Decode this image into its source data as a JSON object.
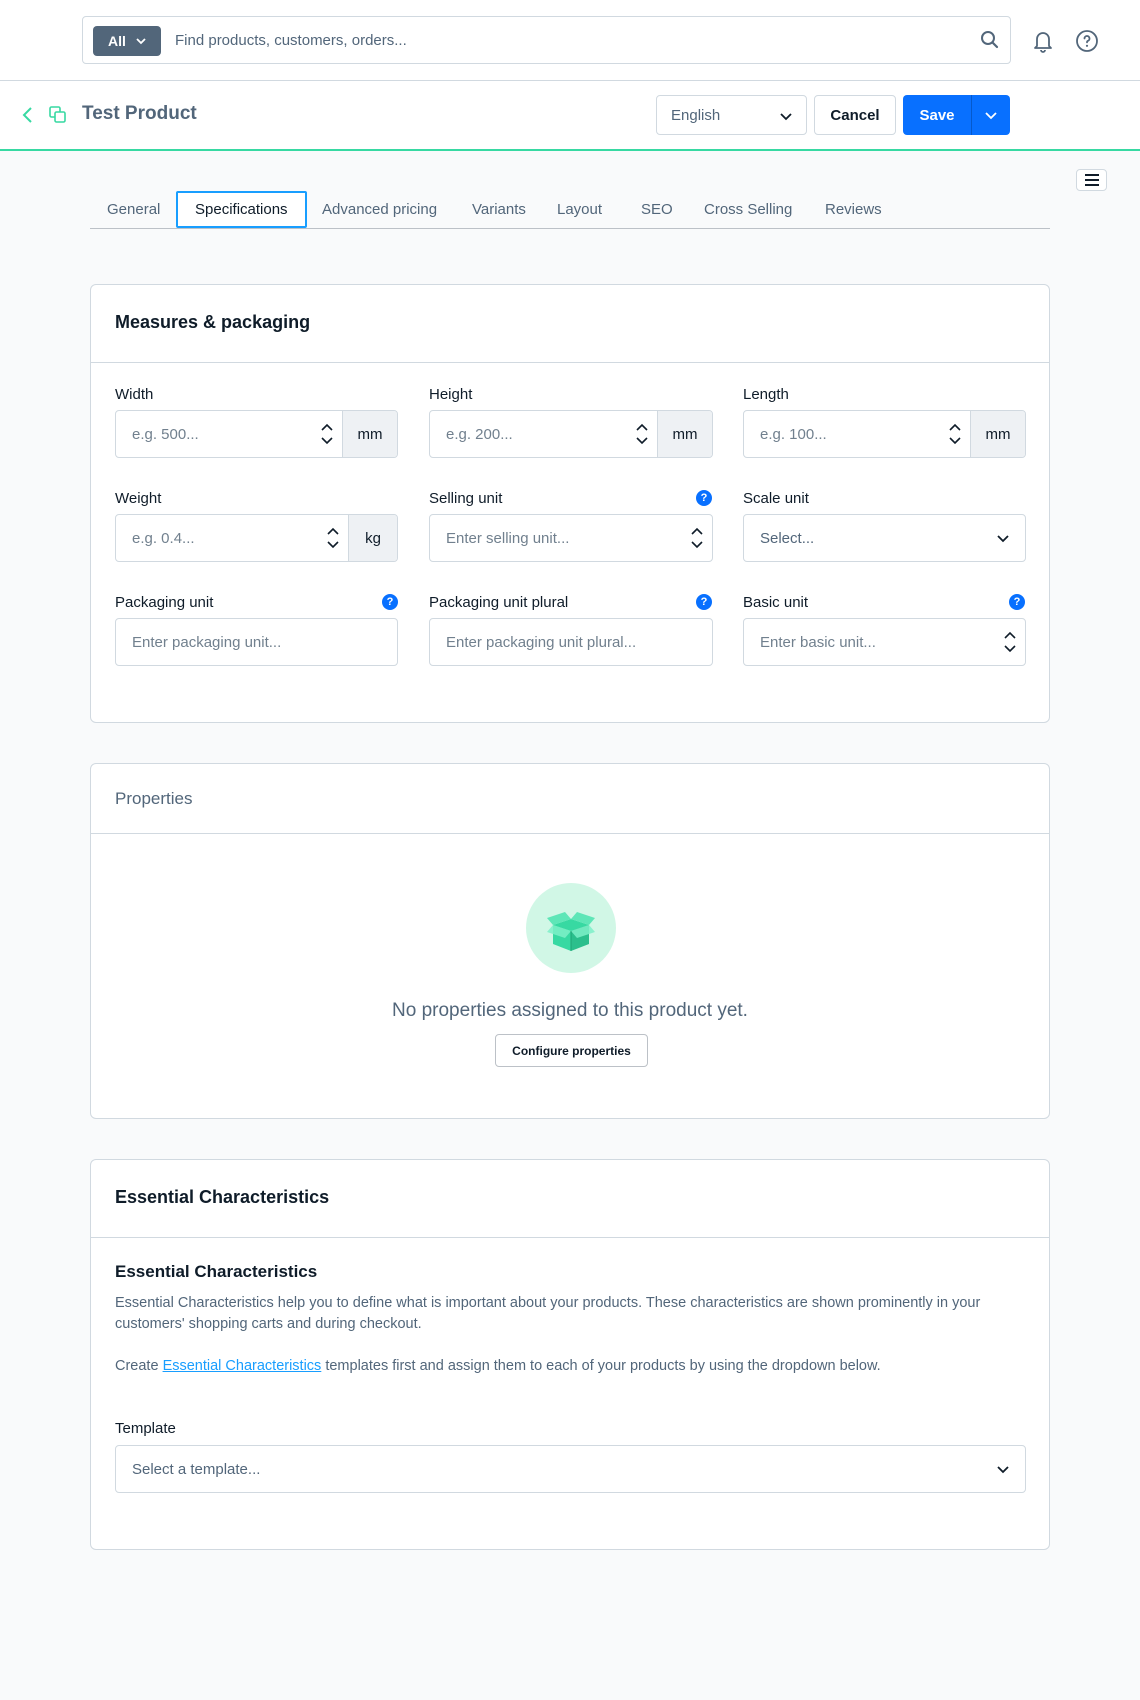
{
  "search": {
    "type_label": "All",
    "placeholder": "Find products, customers, orders..."
  },
  "smartbar": {
    "title": "Test Product",
    "language": "English",
    "cancel_label": "Cancel",
    "save_label": "Save"
  },
  "tabs": [
    {
      "label": "General"
    },
    {
      "label": "Specifications"
    },
    {
      "label": "Advanced pricing"
    },
    {
      "label": "Variants"
    },
    {
      "label": "Layout"
    },
    {
      "label": "SEO"
    },
    {
      "label": "Cross Selling"
    },
    {
      "label": "Reviews"
    }
  ],
  "measures": {
    "title": "Measures & packaging",
    "width": {
      "label": "Width",
      "placeholder": "e.g. 500...",
      "unit": "mm"
    },
    "height": {
      "label": "Height",
      "placeholder": "e.g. 200...",
      "unit": "mm"
    },
    "length": {
      "label": "Length",
      "placeholder": "e.g. 100...",
      "unit": "mm"
    },
    "weight": {
      "label": "Weight",
      "placeholder": "e.g. 0.4...",
      "unit": "kg"
    },
    "selling_unit": {
      "label": "Selling unit",
      "placeholder": "Enter selling unit..."
    },
    "scale_unit": {
      "label": "Scale unit",
      "value": "Select..."
    },
    "packaging_unit": {
      "label": "Packaging unit",
      "placeholder": "Enter packaging unit..."
    },
    "packaging_unit_plural": {
      "label": "Packaging unit plural",
      "placeholder": "Enter packaging unit plural..."
    },
    "basic_unit": {
      "label": "Basic unit",
      "placeholder": "Enter basic unit..."
    },
    "help_glyph": "?"
  },
  "properties": {
    "title": "Properties",
    "empty_text": "No properties assigned to this product yet.",
    "configure_label": "Configure properties"
  },
  "essential": {
    "title": "Essential Characteristics",
    "subtitle": "Essential Characteristics",
    "description": "Essential Characteristics help you to define what is important about your products. These characteristics are shown prominently in your customers' shopping carts and during checkout.",
    "create_prefix": "Create ",
    "create_link": "Essential Characteristics",
    "create_suffix": " templates first and assign them to each of your products by using the dropdown below.",
    "template_label": "Template",
    "template_placeholder": "Select a template..."
  },
  "colors": {
    "accent": "#0870ff",
    "highlight": "#37d9a2",
    "tab_active": "#189eff"
  }
}
